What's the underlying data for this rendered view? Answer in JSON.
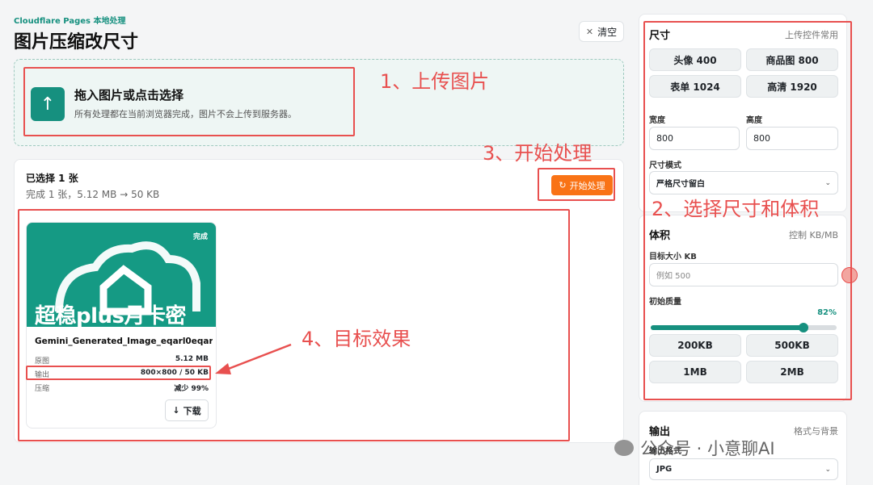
{
  "header": {
    "brand": "Cloudflare Pages 本地处理",
    "title": "图片压缩改尺寸",
    "clear_label": "清空"
  },
  "upload": {
    "title": "拖入图片或点击选择",
    "desc": "所有处理都在当前浏览器完成，图片不会上传到服务器。"
  },
  "selection": {
    "count": "已选择 1 张",
    "summary": "完成 1 张，5.12 MB → 50 KB",
    "start_label": "开始处理"
  },
  "result": {
    "badge": "完成",
    "overlay_text": "超稳plus月卡密",
    "filename": "Gemini_Generated_Image_eqarl0eqar...",
    "rows": [
      {
        "label": "原图",
        "value": "5.12 MB"
      },
      {
        "label": "输出",
        "value": "800×800 / 50 KB"
      },
      {
        "label": "压缩",
        "value": "减少 99%"
      }
    ],
    "download_label": "下载"
  },
  "size_panel": {
    "title": "尺寸",
    "hint": "上传控件常用",
    "presets": [
      "头像 400",
      "商品图 800",
      "表单 1024",
      "高清 1920"
    ],
    "width_label": "宽度",
    "width_value": "800",
    "height_label": "高度",
    "height_value": "800",
    "mode_label": "尺寸模式",
    "mode_value": "严格尺寸留白"
  },
  "volume_panel": {
    "title": "体积",
    "hint": "控制 KB/MB",
    "target_label": "目标大小 KB",
    "target_placeholder": "例如 500",
    "quality_label": "初始质量",
    "quality_value": "82%",
    "quality": 0.82,
    "presets": [
      "200KB",
      "500KB",
      "1MB",
      "2MB"
    ]
  },
  "output_panel": {
    "title": "输出",
    "hint": "格式与背景",
    "format_label": "输出格式",
    "format_value": "JPG"
  },
  "annotations": {
    "a1": "1、上传图片",
    "a2": "2、选择尺寸和体积",
    "a3": "3、开始处理",
    "a4": "4、目标效果"
  },
  "watermark": "公众号 · 小意聊AI",
  "colors": {
    "accent": "#16907f",
    "orange": "#f97316",
    "annotation_red": "#e8504f"
  }
}
